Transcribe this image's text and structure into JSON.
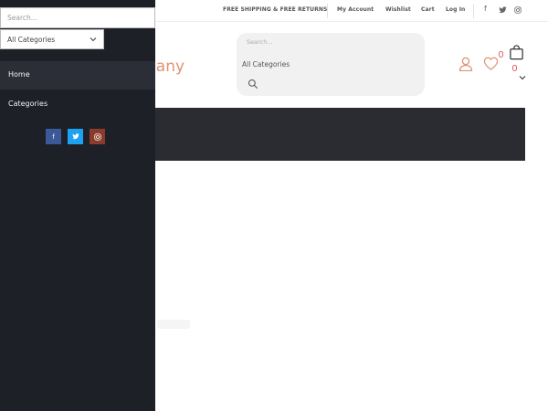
{
  "topbar": {
    "promo": "FREE SHIPPING & FREE RETURNS",
    "links": [
      "My Account",
      "Wishlist",
      "Cart",
      "Log In"
    ],
    "social_icons": [
      "facebook-icon",
      "twitter-icon",
      "instagram-icon"
    ]
  },
  "header": {
    "logo_text": "pany",
    "search_placeholder": "Search...",
    "category_select": "All Categories",
    "icons": [
      "user-icon",
      "heart-icon",
      "bag-icon",
      "chevron-down-icon"
    ]
  },
  "sidebar": {
    "search_placeholder": "Search...",
    "category_select": "All Categories",
    "menu": [
      {
        "label": "Home",
        "active": true
      },
      {
        "label": "Categories",
        "active": false
      }
    ],
    "social": [
      {
        "icon": "facebook-icon",
        "color": "#3b5998"
      },
      {
        "icon": "twitter-icon",
        "color": "#1da1f2"
      },
      {
        "icon": "instagram-icon",
        "color": "#8a3b2c"
      }
    ]
  },
  "colors": {
    "accent": "#e09270",
    "sidebar_bg": "#1e2028",
    "band_bg": "#2a2c31",
    "badge": "#e2675e"
  }
}
